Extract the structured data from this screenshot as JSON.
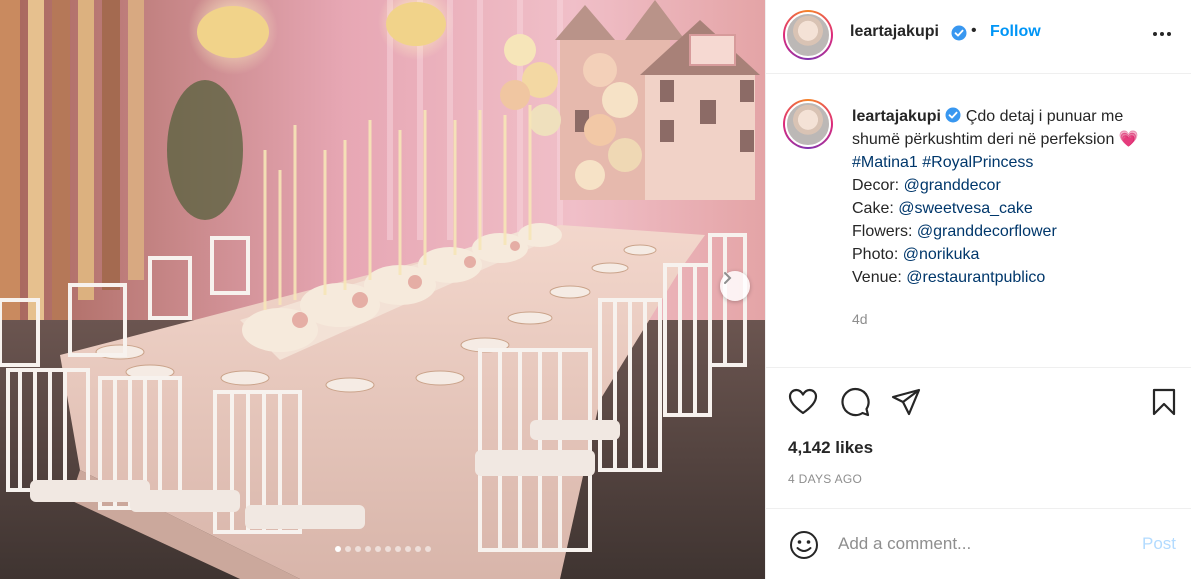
{
  "post": {
    "username": "leartajakupi",
    "verified": true,
    "follow_label": "Follow",
    "bullet": "•",
    "caption": {
      "text": "Çdo detaj i punuar me",
      "text_cont": "shumë përkushtim deri në perfeksion",
      "emoji": "💗",
      "hashtags": "#Matina1 #RoyalPrincess",
      "credits": [
        {
          "label": "Decor:",
          "handle": "@granddecor"
        },
        {
          "label": "Cake:",
          "handle": "@sweetvesa_cake"
        },
        {
          "label": "Flowers:",
          "handle": "@granddecorflower"
        },
        {
          "label": "Photo:",
          "handle": "@norikuka"
        },
        {
          "label": "Venue:",
          "handle": "@restaurantpublico"
        }
      ]
    },
    "caption_time": "4d",
    "likes": "4,142 likes",
    "posted_ago": "4 DAYS AGO",
    "comment_placeholder": "Add a comment...",
    "post_label": "Post",
    "carousel": {
      "total": 10,
      "current": 1
    }
  },
  "colors": {
    "accent": "#0095f6",
    "link": "#00376b",
    "muted": "#8e8e8e",
    "post_disabled": "#b3dbff"
  },
  "icons": [
    "more-options-icon",
    "verified-badge-icon",
    "heart-icon",
    "comment-icon",
    "share-icon",
    "bookmark-icon",
    "emoji-icon",
    "chevron-right-icon"
  ]
}
